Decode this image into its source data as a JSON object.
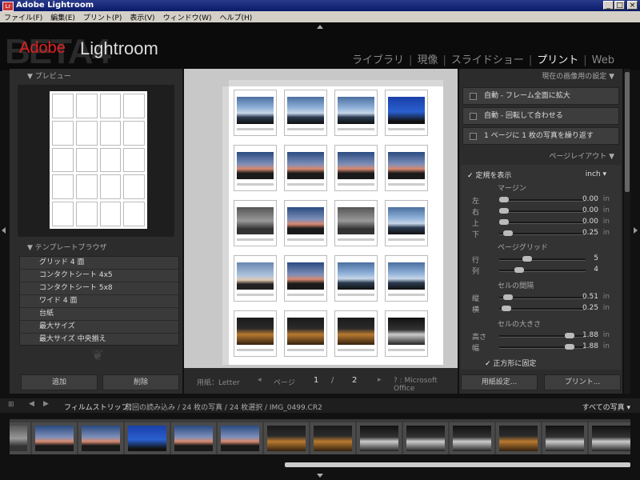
{
  "window": {
    "title": "Adobe Lightroom",
    "icon": "Lr"
  },
  "menu": [
    "ファイル(F)",
    "編集(E)",
    "プリント(P)",
    "表示(V)",
    "ウィンドウ(W)",
    "ヘルプ(H)"
  ],
  "logo": {
    "beta": "BETA4",
    "adobe": "Adobe",
    "product": "Lightroom"
  },
  "modules": [
    {
      "label": "ライブラリ",
      "active": false
    },
    {
      "label": "現像",
      "active": false
    },
    {
      "label": "スライドショー",
      "active": false
    },
    {
      "label": "プリント",
      "active": true
    },
    {
      "label": "Web",
      "active": false
    }
  ],
  "left": {
    "preview_title": "プレビュー",
    "template_title": "テンプレートブラウザ",
    "templates": [
      "グリッド 4 面",
      "コンタクトシート 4x5",
      "コンタクトシート 5x8",
      "ワイド 4 面",
      "台紙",
      "最大サイズ",
      "最大サイズ 中央揃え"
    ],
    "add_button": "追加",
    "delete_button": "削除"
  },
  "center": {
    "paper_label": "用紙：Letter",
    "page_label": "ページ",
    "page_current": "1",
    "page_sep": "/",
    "page_total": "2",
    "printer": "? : Microsoft Office",
    "grid_styles": [
      "sky1",
      "sky1",
      "sky1",
      "sky3",
      "dusk",
      "dusk",
      "dusk",
      "dusk",
      "gray",
      "dusk",
      "gray",
      "sky1",
      "sky2",
      "dusk",
      "sky1",
      "sky1",
      "night",
      "night",
      "night",
      "nightbw"
    ]
  },
  "right": {
    "settings_title": "現在の画像用の設定",
    "options": [
      "自動 - フレーム全面に拡大",
      "自動 - 回転して合わせる",
      "1 ページに 1 枚の写真を繰り返す"
    ],
    "layout_title": "ページレイアウト",
    "ruler_label": "定規を表示",
    "ruler_unit": "inch",
    "margin_title": "マージン",
    "margins": [
      {
        "label": "左",
        "value": "0.00",
        "unit": "in",
        "pos": 0.0
      },
      {
        "label": "右",
        "value": "0.00",
        "unit": "in",
        "pos": 0.0
      },
      {
        "label": "上",
        "value": "0.00",
        "unit": "in",
        "pos": 0.0
      },
      {
        "label": "下",
        "value": "0.25",
        "unit": "in",
        "pos": 0.05
      }
    ],
    "grid_title": "ページグリッド",
    "grid": [
      {
        "label": "行",
        "value": "5",
        "pos": 0.3
      },
      {
        "label": "列",
        "value": "4",
        "pos": 0.2
      }
    ],
    "spacing_title": "セルの間隔",
    "spacing": [
      {
        "label": "縦",
        "value": "0.51",
        "unit": "in",
        "pos": 0.05
      },
      {
        "label": "横",
        "value": "0.25",
        "unit": "in",
        "pos": 0.03
      }
    ],
    "cellsize_title": "セルの大きさ",
    "cellsize": [
      {
        "label": "高さ",
        "value": "1.88",
        "unit": "in",
        "pos": 0.85
      },
      {
        "label": "幅",
        "value": "1.88",
        "unit": "in",
        "pos": 0.85
      }
    ],
    "square_label": "正方形に固定",
    "page_setup_button": "用紙設定...",
    "print_button": "プリント..."
  },
  "filmstrip": {
    "label": "フィルムストリップ：",
    "info": "前回の読み込み / 24 枚の写真 / 24 枚選択 / IMG_0499.CR2",
    "filter": "すべての写真",
    "thumbs": [
      "gray",
      "dusk",
      "dusk",
      "sky3",
      "dusk",
      "dusk",
      "night",
      "night",
      "nightbw",
      "nightbw",
      "nightbw",
      "night",
      "nightbw",
      "nightbw"
    ]
  }
}
